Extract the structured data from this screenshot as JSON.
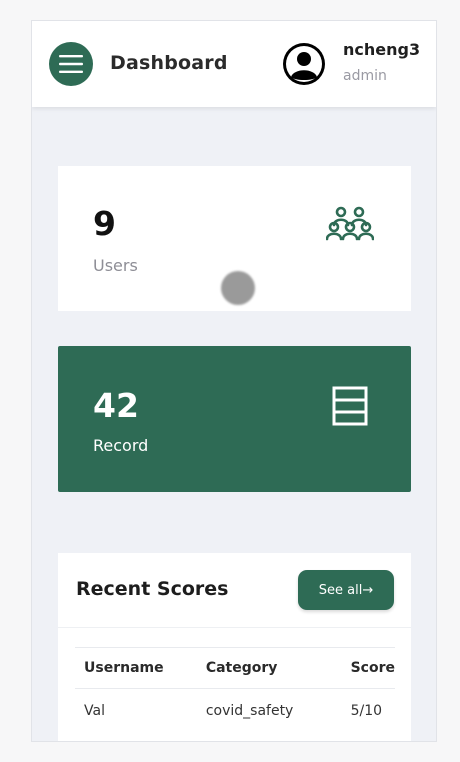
{
  "header": {
    "title": "Dashboard",
    "menu_icon": "menu-icon",
    "user": {
      "name": "ncheng3",
      "role": "admin",
      "avatar_icon": "user-avatar-icon"
    }
  },
  "stats": {
    "users": {
      "value": "9",
      "label": "Users",
      "icon": "users-group-icon"
    },
    "records": {
      "value": "42",
      "label": "Record",
      "icon": "table-icon"
    }
  },
  "recent_scores": {
    "title": "Recent Scores",
    "see_all_label": "See all→",
    "columns": [
      "Username",
      "Category",
      "Score"
    ],
    "rows": [
      [
        "Val",
        "covid_safety",
        "5/10"
      ]
    ]
  },
  "colors": {
    "accent": "#2e6b55",
    "background": "#eff1f6",
    "card": "#ffffff"
  }
}
